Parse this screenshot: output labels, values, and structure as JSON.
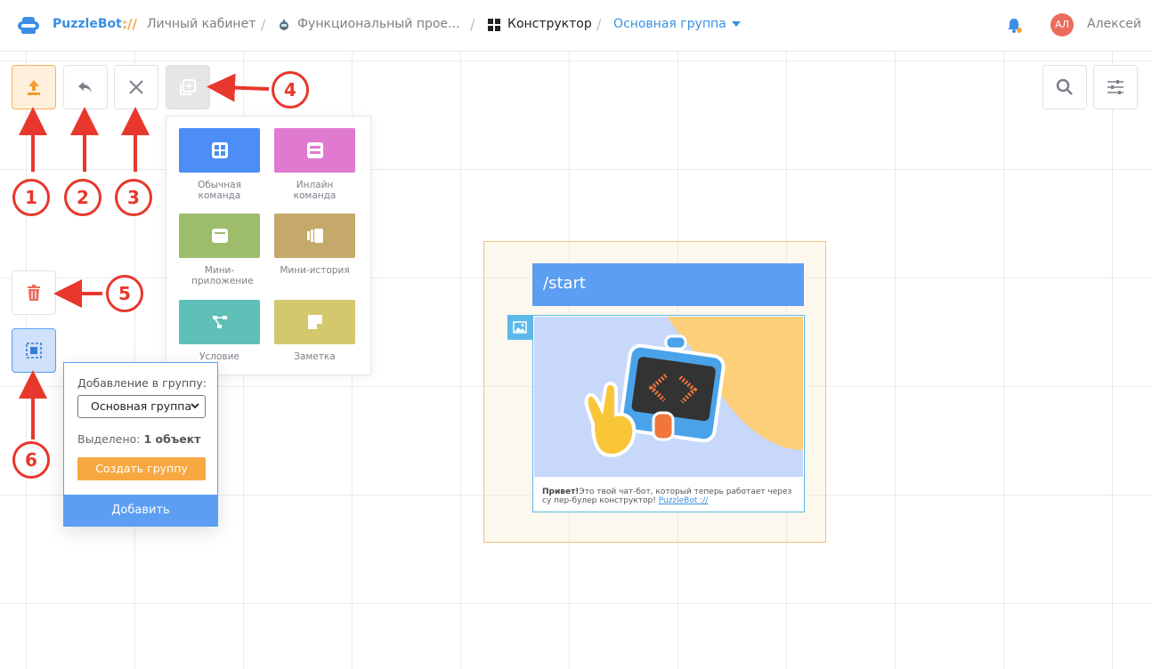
{
  "header": {
    "brand": "PuzzleBot",
    "brand_separator": "://",
    "breadcrumb": [
      {
        "label": "Личный кабинет"
      },
      {
        "label": "Функциональный прое..."
      },
      {
        "label": "Конструктор"
      },
      {
        "label": "Основная группа"
      }
    ],
    "separator": "/",
    "user": {
      "initials": "АЛ",
      "name": "Алексей"
    }
  },
  "toolbar": {
    "icons": [
      "upload-icon",
      "undo-icon",
      "close-icon",
      "add-block-icon",
      "search-icon",
      "settings-sliders-icon",
      "trash-icon",
      "select-group-icon"
    ]
  },
  "annotations": [
    "1",
    "2",
    "3",
    "4",
    "5",
    "6"
  ],
  "palette": {
    "items": [
      {
        "label": "Обычная команда",
        "color": "#4c8ef5",
        "icon": "grid-icon"
      },
      {
        "label": "Инлайн команда",
        "color": "#e07ad0",
        "icon": "inline-list-icon"
      },
      {
        "label": "Мини-приложение",
        "color": "#9ebd6c",
        "icon": "window-icon"
      },
      {
        "label": "Мини-история",
        "color": "#c5a96a",
        "icon": "stories-icon"
      },
      {
        "label": "Условие",
        "color": "#5ec0b7",
        "icon": "branch-icon"
      },
      {
        "label": "Заметка",
        "color": "#d3c86c",
        "icon": "note-icon"
      }
    ]
  },
  "group_popup": {
    "label": "Добавление в группу:",
    "selected_group": "Основная группа",
    "selected_count_label": "Выделено:",
    "selected_count_value": "1 объект",
    "create_button": "Создать группу",
    "add_button": "Добавить"
  },
  "block": {
    "command": "/start",
    "message_bold": "Привет!",
    "message_text": "Это твой чат-бот, который теперь работает через су пер-булер конструктор!",
    "message_link": "PuzzleBot ://"
  },
  "colors": {
    "accent_blue": "#5b9ef2",
    "accent_orange": "#f8a841",
    "annotation_red": "#e8372c"
  }
}
